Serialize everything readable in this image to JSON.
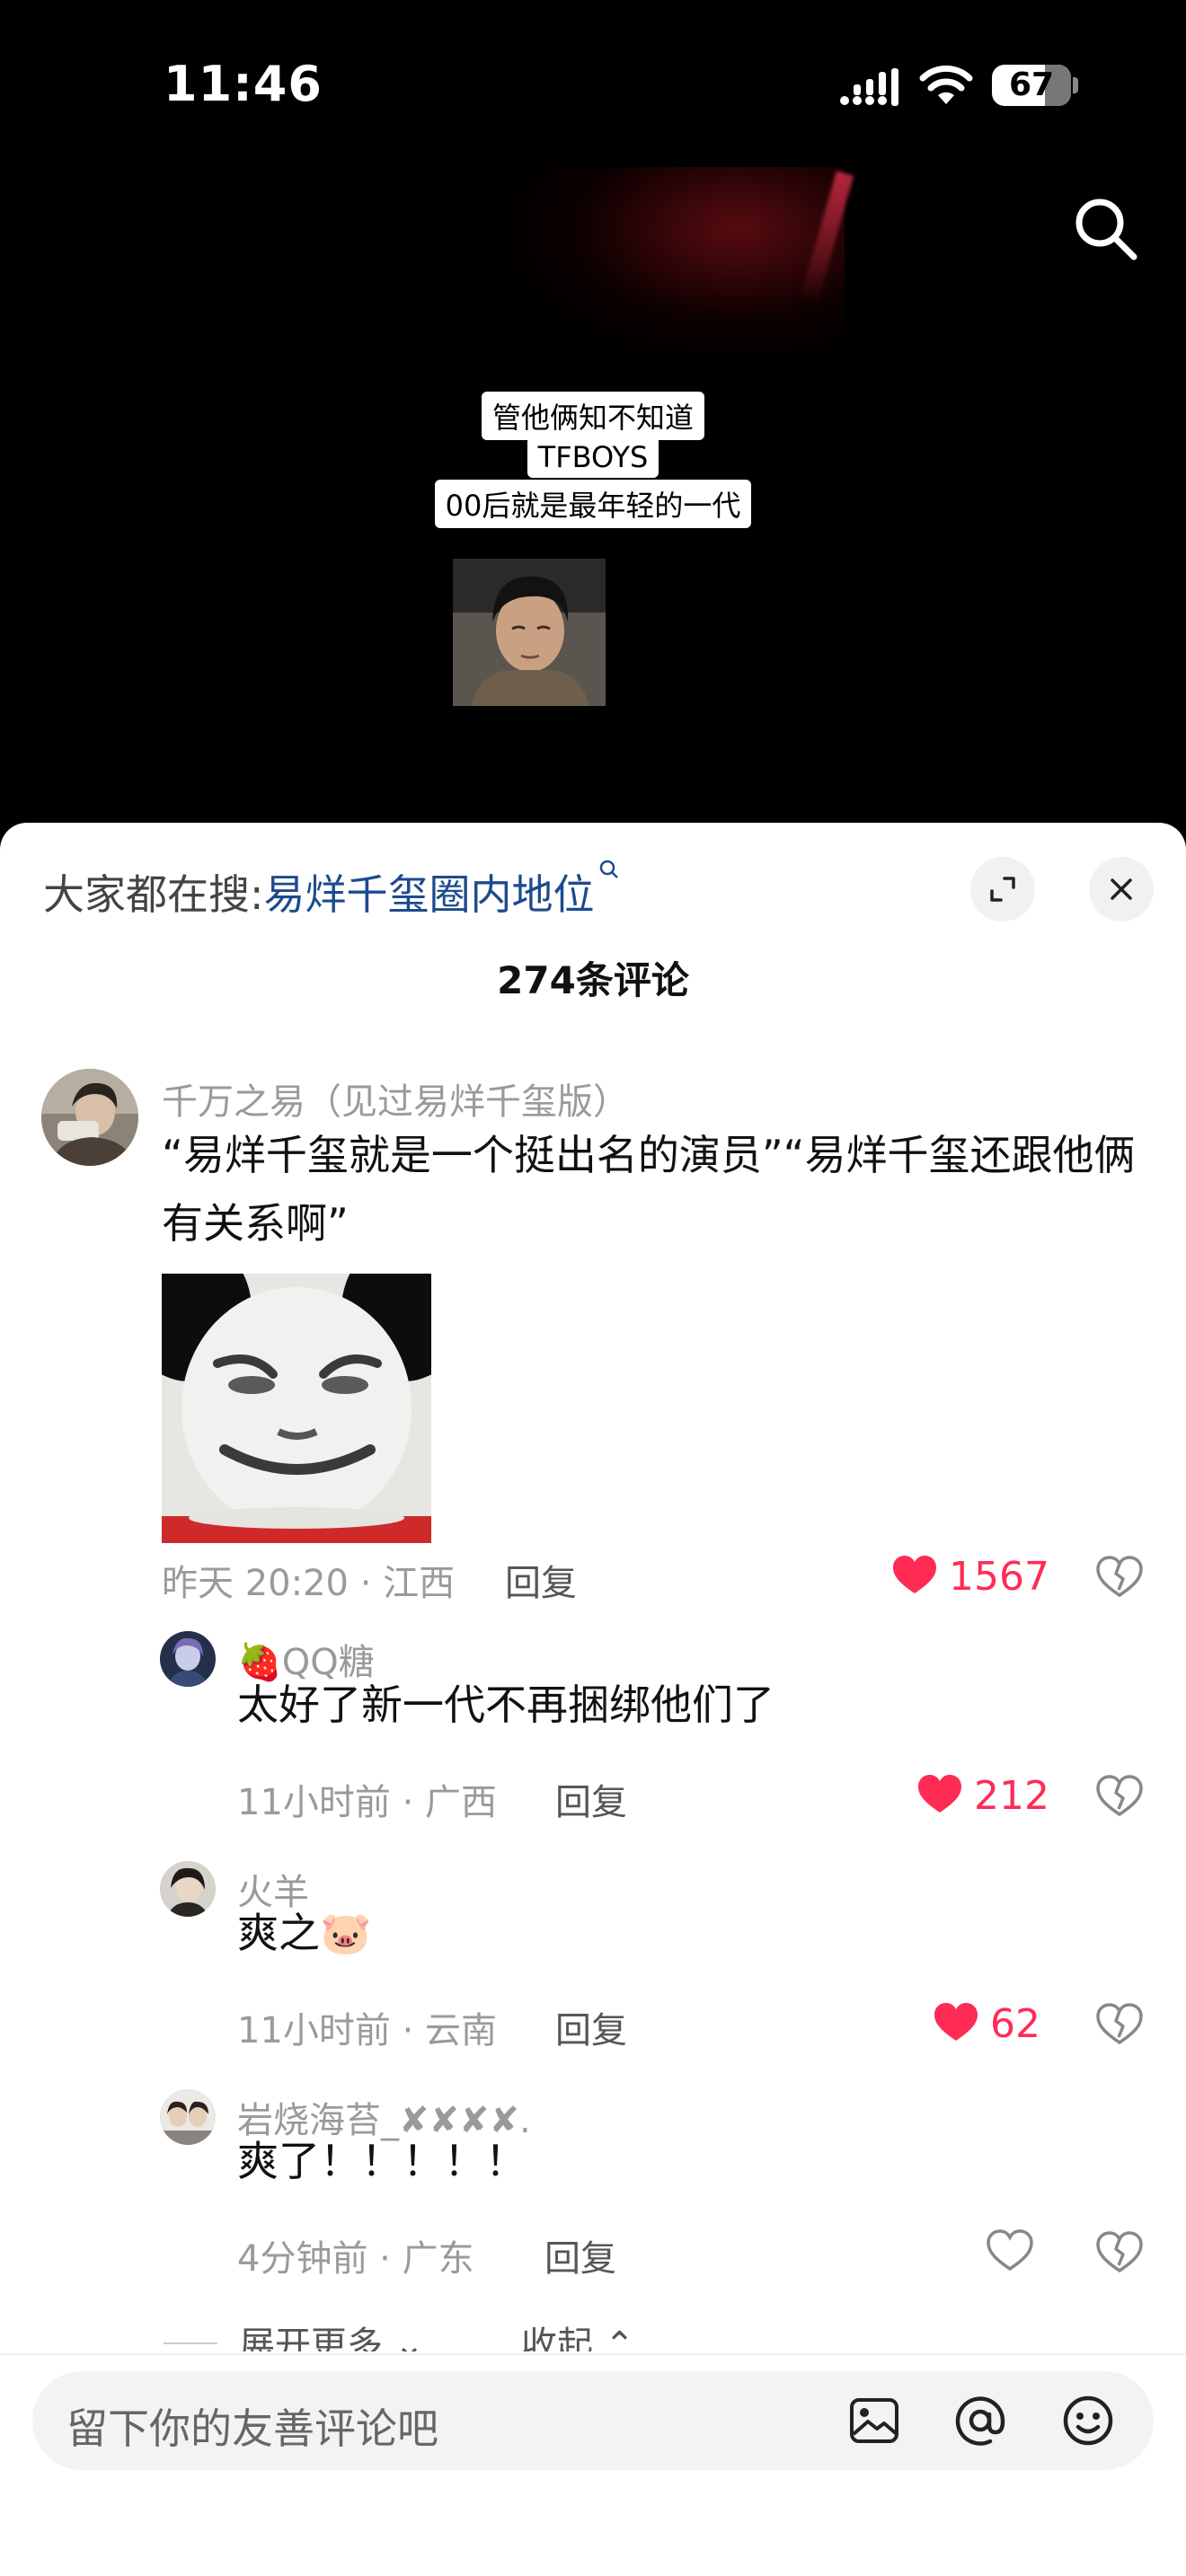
{
  "status_bar": {
    "time": "11:46",
    "battery": "67",
    "battery_level": 0.67
  },
  "video": {
    "caption_lines": [
      "管他俩知不知道",
      "TFBOYS",
      "00后就是最年轻的一代"
    ]
  },
  "header": {
    "hot_search_prefix": "大家都在搜:",
    "hot_search_term": "易烊千玺圈内地位",
    "comment_count": "274条评论"
  },
  "comments": [
    {
      "user": "千万之易（见过易烊千玺版）",
      "text": "“易烊千玺就是一个挺出名的演员”“易烊千玺还跟他俩有关系啊”",
      "time_location": "昨天 20:20 · 江西",
      "reply_label": "回复",
      "likes": "1567",
      "liked": true
    }
  ],
  "replies": [
    {
      "user": "🍓QQ糖",
      "text": "太好了新一代不再捆绑他们了",
      "time_location": "11小时前 · 广西",
      "reply_label": "回复",
      "likes": "212",
      "liked": true
    },
    {
      "user": "火羊",
      "text": "爽之🐷",
      "time_location": "11小时前 · 云南",
      "reply_label": "回复",
      "likes": "62",
      "liked": true
    },
    {
      "user": "岩烧海苔_✘✘✘✘.",
      "text": "爽了！！！！！",
      "time_location": "4分钟前 · 广东",
      "reply_label": "回复",
      "likes": "",
      "liked": false
    }
  ],
  "more": {
    "expand_label": "展开更多",
    "collapse_label": "收起"
  },
  "input_bar": {
    "placeholder": "留下你的友善评论吧"
  },
  "colors": {
    "accent": "#fe2c55",
    "link": "#1d4a8c",
    "muted": "#9a9a9a"
  }
}
